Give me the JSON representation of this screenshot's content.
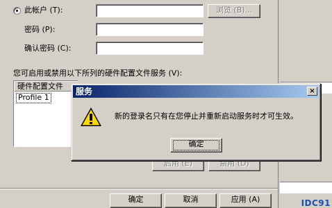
{
  "account": {
    "radio_label": "此帐户 (T):",
    "password_label": "密码 (P):",
    "confirm_label": "确认密码 (C):",
    "browse_button": "浏览 (B)..."
  },
  "hardware": {
    "label": "您可启用或禁用以下所列的硬件配置文件服务 (V):",
    "column_header": "硬件配置文件",
    "profile_item": "Profile 1",
    "enable_button": "启用 (E)",
    "disable_button": "禁用 (D)"
  },
  "footer": {
    "ok": "确定",
    "cancel": "取消",
    "apply": "应用 (A)"
  },
  "dialog": {
    "title": "服务",
    "message": "新的登录名只有在您停止并重新启动服务时才可生效。",
    "ok_button": "确定"
  },
  "watermark": "IDC91",
  "icons": {
    "warning": "warning-icon",
    "close": "close-icon"
  },
  "colors": {
    "face": "#d4d0c8",
    "titlebar_start": "#0a246a",
    "titlebar_end": "#a6caf0",
    "warning_yellow": "#ffd800"
  }
}
